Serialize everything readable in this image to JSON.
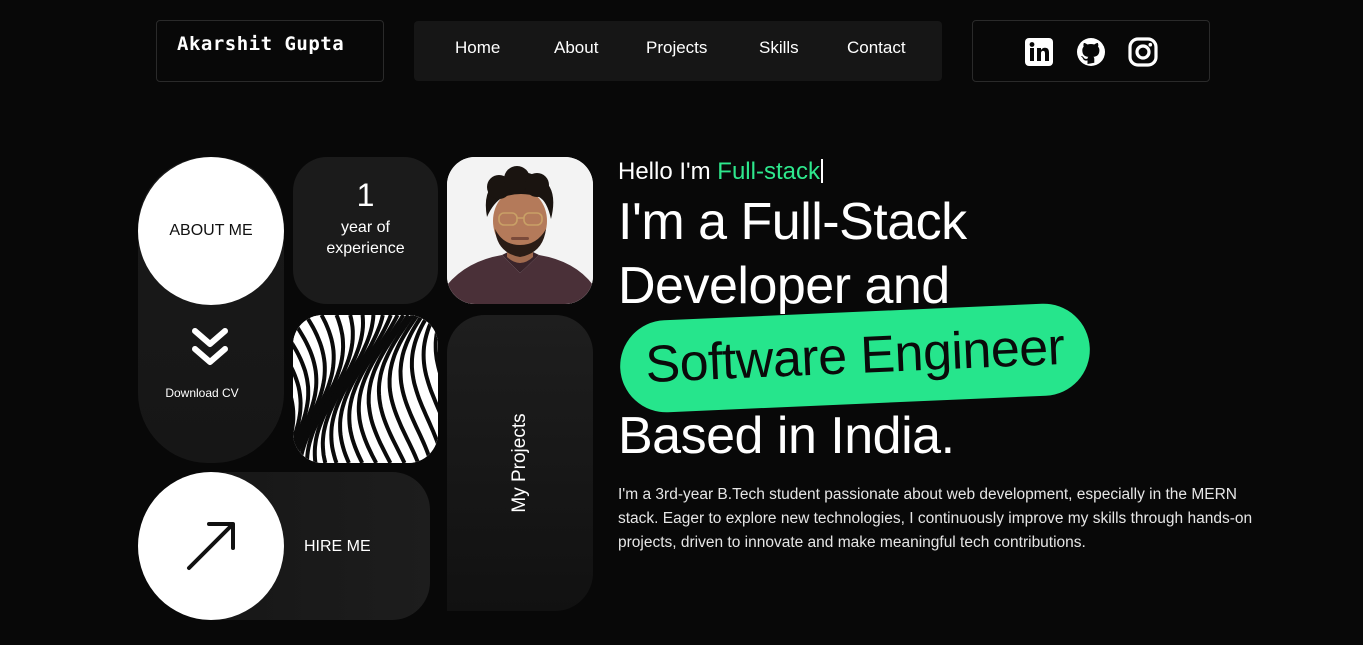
{
  "header": {
    "logo": "Akarshit Gupta",
    "nav": [
      {
        "label": "Home"
      },
      {
        "label": "About"
      },
      {
        "label": "Projects"
      },
      {
        "label": "Skills"
      },
      {
        "label": "Contact"
      }
    ],
    "social": [
      {
        "icon": "linkedin-icon"
      },
      {
        "icon": "github-icon"
      },
      {
        "icon": "instagram-icon"
      }
    ]
  },
  "tiles": {
    "about": "ABOUT ME",
    "download": "Download CV",
    "experience_number": "1",
    "experience_line1": "year of",
    "experience_line2": "experience",
    "projects": "My Projects",
    "hire": "HIRE ME"
  },
  "hero": {
    "hello_prefix": "Hello I'm",
    "hello_highlight": "Full-stack",
    "line1": "I'm a Full-Stack",
    "line2": "Developer and",
    "highlight": "Software Engineer",
    "line4": "Based in India.",
    "description": "I'm a 3rd-year B.Tech student passionate about web development, especially in the MERN stack. Eager to explore new technologies, I continuously improve my skills through hands-on projects, driven to innovate and make meaningful tech contributions."
  },
  "colors": {
    "background": "#080808",
    "accent": "#26e58c",
    "tile": "#1b1b1b"
  }
}
